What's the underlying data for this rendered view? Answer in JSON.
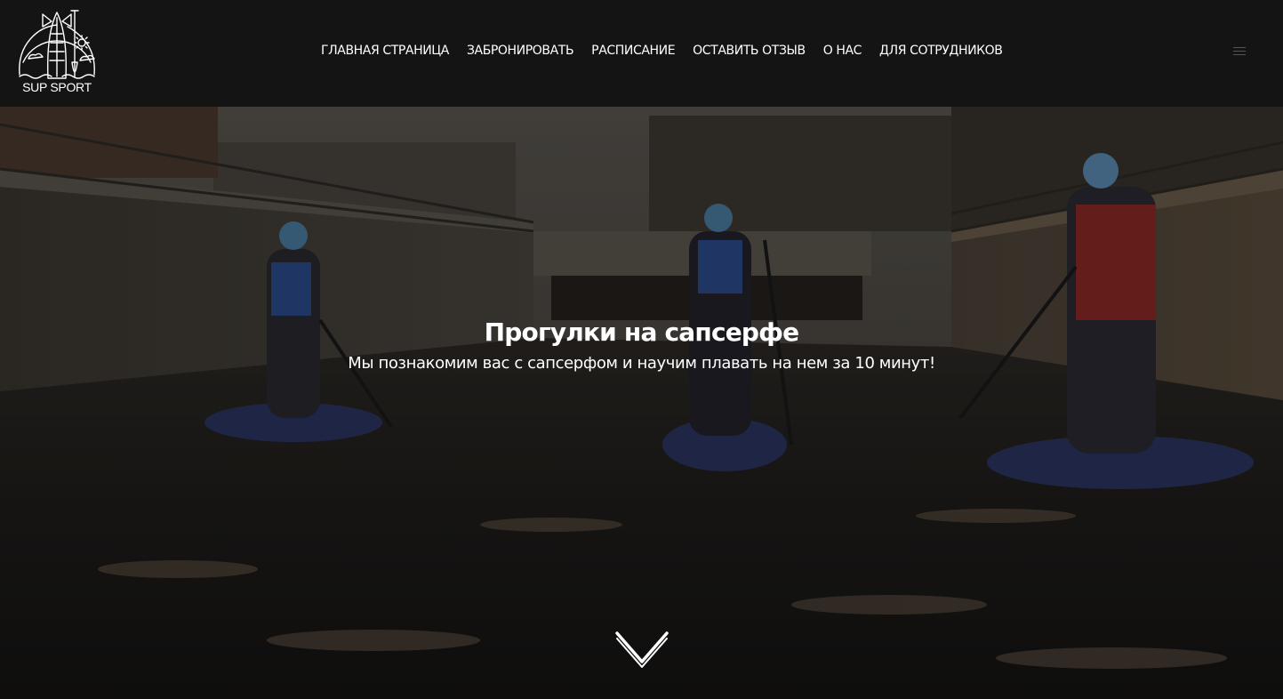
{
  "logo": {
    "text": "SUP SPORT",
    "icon": "sup-paddle-logo-icon"
  },
  "nav": {
    "items": [
      {
        "label": "ГЛАВНАЯ СТРАНИЦА"
      },
      {
        "label": "ЗАБРОНИРОВАТЬ"
      },
      {
        "label": "РАСПИСАНИЕ"
      },
      {
        "label": "ОСТАВИТЬ ОТЗЫВ"
      },
      {
        "label": "О НАС"
      },
      {
        "label": "ДЛЯ СОТРУДНИКОВ"
      }
    ],
    "menu_icon": "hamburger-menu-icon"
  },
  "hero": {
    "title": "Прогулки на сапсерфе",
    "subtitle": "Мы познакомим вас с сапсерфом и научим плавать на нем за 10 минут!",
    "scroll_icon": "chevron-down-icon"
  },
  "colors": {
    "header_bg": "#141414",
    "text": "#ffffff"
  }
}
